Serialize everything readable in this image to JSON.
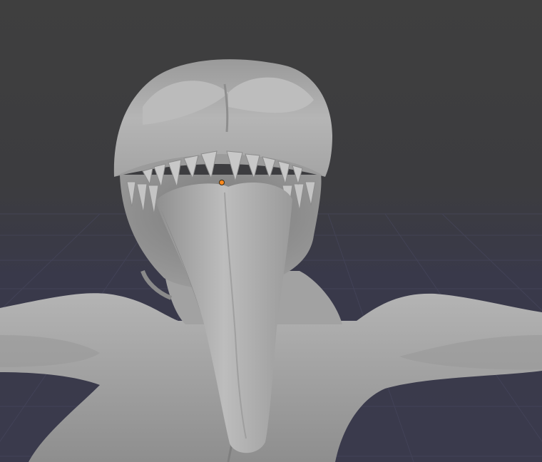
{
  "viewport": {
    "background_top": "#3f3f3f",
    "background_bottom": "#3a3a4c",
    "grid_color": "#4a4a62",
    "model_color": "#a9a9a9",
    "origin_color": "#ff8a1f"
  }
}
